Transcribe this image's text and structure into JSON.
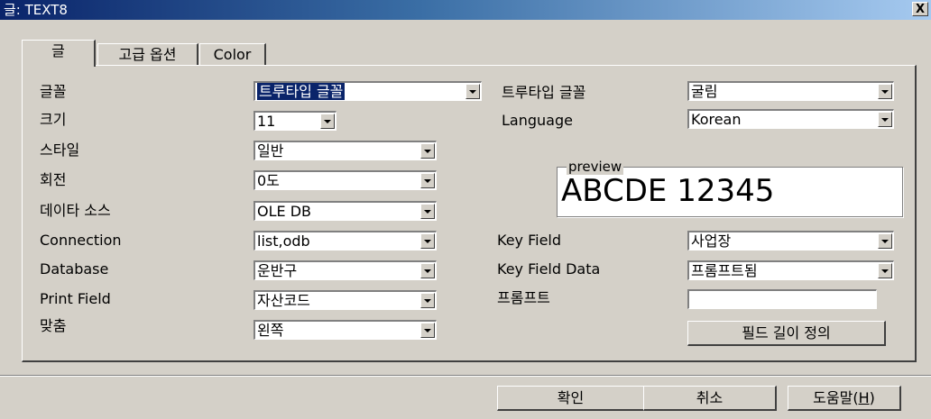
{
  "window": {
    "title": "글: TEXT8",
    "close_label": "X"
  },
  "tabs": [
    {
      "label": "글",
      "active": true
    },
    {
      "label": "고급 옵션",
      "active": false
    },
    {
      "label": "Color",
      "active": false
    }
  ],
  "left_fields": {
    "font": {
      "label": "글꼴",
      "value": "트루타입 글꼴"
    },
    "size": {
      "label": "크기",
      "value": "11"
    },
    "style": {
      "label": "스타일",
      "value": "일반"
    },
    "rotation": {
      "label": "회전",
      "value": "0도"
    },
    "data_source": {
      "label": "데이타 소스",
      "value": "OLE DB"
    },
    "connection": {
      "label": "Connection",
      "value": "list,odb"
    },
    "database": {
      "label": "Database",
      "value": "운반구"
    },
    "print_field": {
      "label": "Print Field",
      "value": "자산코드"
    },
    "align": {
      "label": "맞춤",
      "value": "왼쪽"
    }
  },
  "right_fields": {
    "truetype_font": {
      "label": "트루타입 글꼴",
      "value": "굴림"
    },
    "language": {
      "label": "Language",
      "value": "Korean"
    },
    "preview": {
      "legend": "preview",
      "text": "ABCDE 12345"
    },
    "key_field": {
      "label": "Key Field",
      "value": "사업장"
    },
    "key_field_data": {
      "label": "Key Field Data",
      "value": "프롬프트됨"
    },
    "prompt": {
      "label": "프롬프트",
      "value": ""
    },
    "field_length_button": "필드 길이 정의"
  },
  "buttons": {
    "ok": "확인",
    "cancel": "취소",
    "help": "도움말(",
    "help_key": "H",
    "help_close": ")"
  }
}
